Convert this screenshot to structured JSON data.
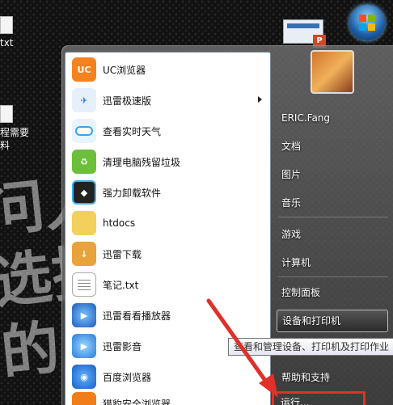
{
  "desktop": {
    "icon1_label": "txt",
    "icon2_line1": "程需要",
    "icon2_line2": "料",
    "bg_text_line1": "问人",
    "bg_text_line2": "选择",
    "bg_text_line3": "的"
  },
  "ppt_badge": "P",
  "programs": [
    {
      "label": "UC浏览器",
      "icon": "uc-browser-icon",
      "has_arrow": false
    },
    {
      "label": "迅雷极速版",
      "icon": "xunlei-icon",
      "has_arrow": true
    },
    {
      "label": "查看实时天气",
      "icon": "weather-icon",
      "has_arrow": false
    },
    {
      "label": "清理电脑残留垃圾",
      "icon": "recycle-icon",
      "has_arrow": false
    },
    {
      "label": "强力卸载软件",
      "icon": "uninstall-icon",
      "has_arrow": false
    },
    {
      "label": "htdocs",
      "icon": "folder-icon",
      "has_arrow": false
    },
    {
      "label": "迅雷下载",
      "icon": "folder-download-icon",
      "has_arrow": false
    },
    {
      "label": "笔记.txt",
      "icon": "text-file-icon",
      "has_arrow": false
    },
    {
      "label": "迅雷看看播放器",
      "icon": "player-icon",
      "has_arrow": false
    },
    {
      "label": "迅雷影音",
      "icon": "media-player-icon",
      "has_arrow": false
    },
    {
      "label": "百度浏览器",
      "icon": "baidu-browser-icon",
      "has_arrow": false
    },
    {
      "label": "猎豹安全浏览器",
      "icon": "liebao-browser-icon",
      "has_arrow": true
    }
  ],
  "right_menu": {
    "user": "ERIC.Fang",
    "documents": "文档",
    "pictures": "图片",
    "music": "音乐",
    "games": "游戏",
    "computer": "计算机",
    "control_panel": "控制面板",
    "devices_printers": "设备和打印机",
    "help_support": "帮助和支持",
    "run": "运行..."
  },
  "tooltip": "查看和管理设备、打印机及打印作业",
  "colors": {
    "highlight_box": "#e0302a",
    "arrow": "#e0302a"
  }
}
